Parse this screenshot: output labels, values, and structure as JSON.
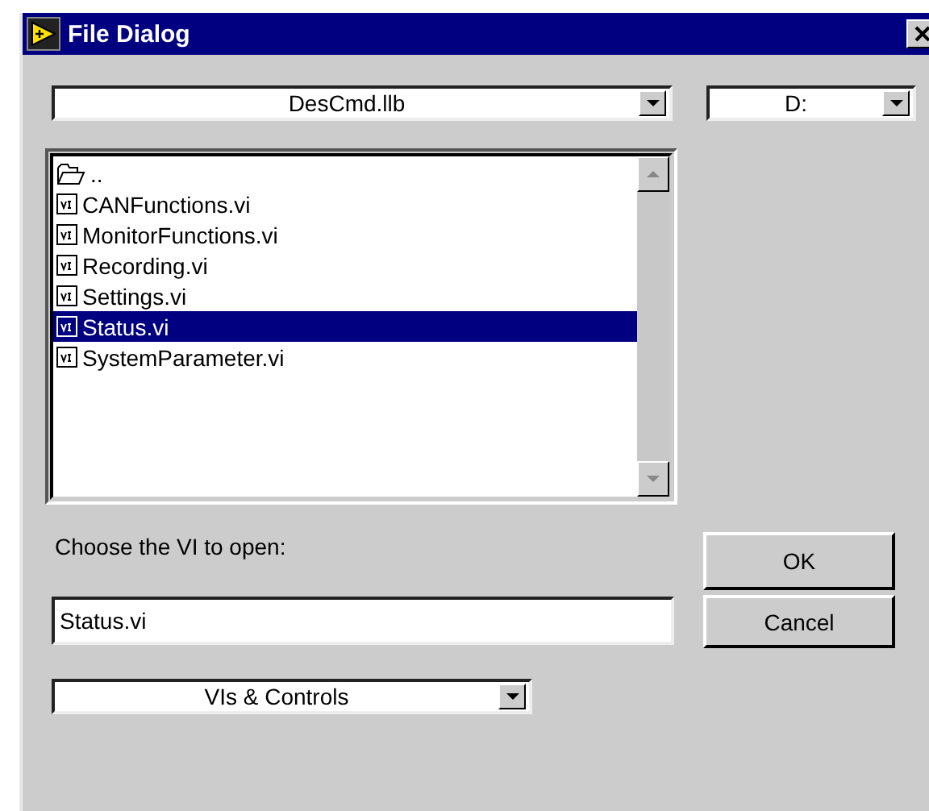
{
  "window": {
    "title": "File Dialog"
  },
  "path_dropdown": {
    "value": "DesCmd.llb"
  },
  "drive_dropdown": {
    "value": "D:"
  },
  "file_list": [
    {
      "kind": "folder",
      "label": "..",
      "selected": false
    },
    {
      "kind": "vi",
      "label": "CANFunctions.vi",
      "selected": false
    },
    {
      "kind": "vi",
      "label": "MonitorFunctions.vi",
      "selected": false
    },
    {
      "kind": "vi",
      "label": "Recording.vi",
      "selected": false
    },
    {
      "kind": "vi",
      "label": "Settings.vi",
      "selected": false
    },
    {
      "kind": "vi",
      "label": "Status.vi",
      "selected": true
    },
    {
      "kind": "vi",
      "label": "SystemParameter.vi",
      "selected": false
    }
  ],
  "prompt": "Choose the VI to open:",
  "filename_field": {
    "value": "Status.vi"
  },
  "buttons": [
    "OK",
    "Cancel"
  ],
  "filter_dropdown": {
    "value": "VIs & Controls"
  }
}
